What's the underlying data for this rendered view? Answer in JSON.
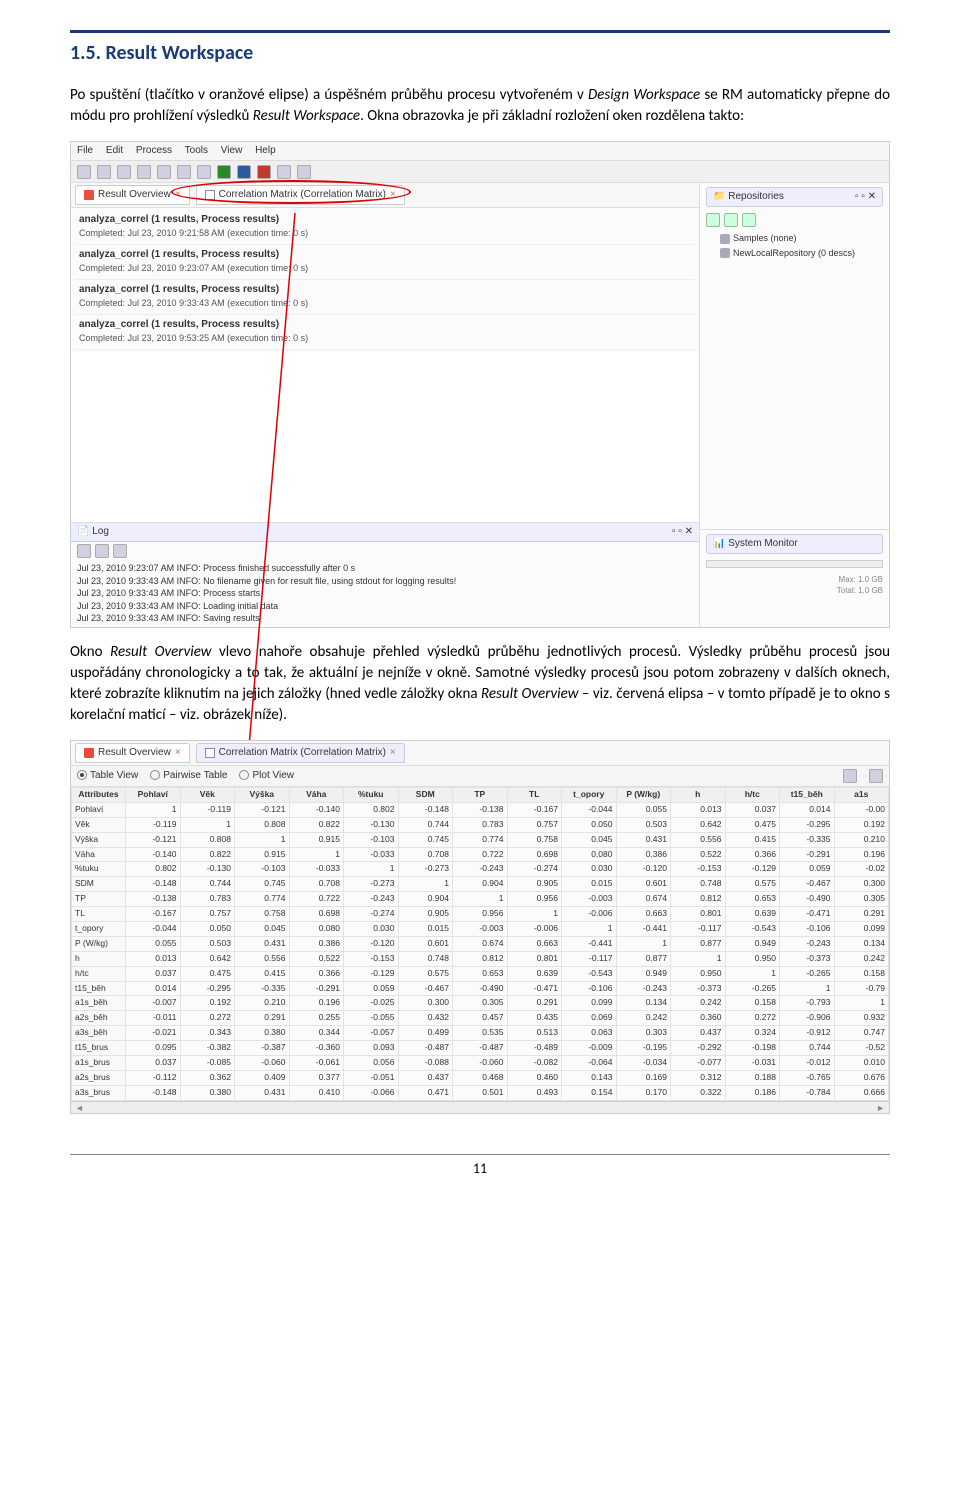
{
  "heading": "1.5. Result Workspace",
  "para1_parts": {
    "a": "Po spuštění (tlačítko v oranžové elipse) a úspěšném průběhu procesu vytvořeném v ",
    "b": "Design Workspace",
    "c": " se RM automaticky přepne do módu pro prohlížení výsledků ",
    "d": "Result Workspace",
    "e": ". Okna obrazovka je při základní rozložení oken rozdělena takto:"
  },
  "menubar": [
    "File",
    "Edit",
    "Process",
    "Tools",
    "View",
    "Help"
  ],
  "tabs": {
    "overview": "Result Overview",
    "corrmatrix": "Correlation Matrix (Correlation Matrix)"
  },
  "repositories": {
    "title": "Repositories",
    "items": [
      "Samples (none)",
      "NewLocalRepository (0 descs)"
    ]
  },
  "result_items": [
    {
      "title": "analyza_correl (1 results, Process results)",
      "sub": "Completed: Jul 23, 2010 9:21:58 AM (execution time: 0 s)"
    },
    {
      "title": "analyza_correl (1 results, Process results)",
      "sub": "Completed: Jul 23, 2010 9:23:07 AM (execution time: 0 s)"
    },
    {
      "title": "analyza_correl (1 results, Process results)",
      "sub": "Completed: Jul 23, 2010 9:33:43 AM (execution time: 0 s)"
    },
    {
      "title": "analyza_correl (1 results, Process results)",
      "sub": "Completed: Jul 23, 2010 9:53:25 AM (execution time: 0 s)"
    }
  ],
  "log": {
    "title": "Log",
    "lines": [
      "Jul 23, 2010 9:23:07 AM INFO: Process finished successfully after 0 s",
      "Jul 23, 2010 9:33:43 AM INFO: No filename given for result file, using stdout for logging results!",
      "Jul 23, 2010 9:33:43 AM INFO: Process starts",
      "Jul 23, 2010 9:33:43 AM INFO: Loading initial data",
      "Jul 23, 2010 9:33:43 AM INFO: Saving results"
    ]
  },
  "sysmon": {
    "title": "System Monitor",
    "max": "Max: 1.0 GB",
    "total": "Total: 1.0 GB"
  },
  "para2_parts": {
    "a": "Okno ",
    "b": "Result Overview",
    "c": " vlevo nahoře obsahuje přehled výsledků průběhu jednotlivých procesů. Výsledky průběhu procesů jsou uspořádány chronologicky a to tak, že aktuální je nejníže v okně. Samotné výsledky procesů jsou potom zobrazeny v dalších oknech, které zobrazíte kliknutím na jejich záložky (hned vedle záložky okna ",
    "d": "Result Overview",
    "e": " – viz. červená elipsa – v tomto případě je to okno s korelační maticí – viz. obrázek níže)."
  },
  "corr_views": {
    "table": "Table View",
    "pairwise": "Pairwise Table",
    "plot": "Plot View"
  },
  "corr_header": [
    "Attributes",
    "Pohlaví",
    "Věk",
    "Výška",
    "Váha",
    "%tuku",
    "SDM",
    "TP",
    "TL",
    "t_opory",
    "P (W/kg)",
    "h",
    "h/tc",
    "t15_běh",
    "a1s"
  ],
  "chart_data": {
    "type": "table",
    "title": "Correlation Matrix",
    "rows": [
      [
        "Pohlaví",
        "1",
        "-0.119",
        "-0.121",
        "-0.140",
        "0.802",
        "-0.148",
        "-0.138",
        "-0.167",
        "-0.044",
        "0.055",
        "0.013",
        "0.037",
        "0.014",
        "-0.00"
      ],
      [
        "Věk",
        "-0.119",
        "1",
        "0.808",
        "0.822",
        "-0.130",
        "0.744",
        "0.783",
        "0.757",
        "0.050",
        "0.503",
        "0.642",
        "0.475",
        "-0.295",
        "0.192"
      ],
      [
        "Výška",
        "-0.121",
        "0.808",
        "1",
        "0.915",
        "-0.103",
        "0.745",
        "0.774",
        "0.758",
        "0.045",
        "0.431",
        "0.556",
        "0.415",
        "-0.335",
        "0.210"
      ],
      [
        "Váha",
        "-0.140",
        "0.822",
        "0.915",
        "1",
        "-0.033",
        "0.708",
        "0.722",
        "0.698",
        "0.080",
        "0.386",
        "0.522",
        "0.366",
        "-0.291",
        "0.196"
      ],
      [
        "%tuku",
        "0.802",
        "-0.130",
        "-0.103",
        "-0.033",
        "1",
        "-0.273",
        "-0.243",
        "-0.274",
        "0.030",
        "-0.120",
        "-0.153",
        "-0.129",
        "0.059",
        "-0.02"
      ],
      [
        "SDM",
        "-0.148",
        "0.744",
        "0.745",
        "0.708",
        "-0.273",
        "1",
        "0.904",
        "0.905",
        "0.015",
        "0.601",
        "0.748",
        "0.575",
        "-0.467",
        "0.300"
      ],
      [
        "TP",
        "-0.138",
        "0.783",
        "0.774",
        "0.722",
        "-0.243",
        "0.904",
        "1",
        "0.956",
        "-0.003",
        "0.674",
        "0.812",
        "0.653",
        "-0.490",
        "0.305"
      ],
      [
        "TL",
        "-0.167",
        "0.757",
        "0.758",
        "0.698",
        "-0.274",
        "0.905",
        "0.956",
        "1",
        "-0.006",
        "0.663",
        "0.801",
        "0.639",
        "-0.471",
        "0.291"
      ],
      [
        "t_opory",
        "-0.044",
        "0.050",
        "0.045",
        "0.080",
        "0.030",
        "0.015",
        "-0.003",
        "-0.006",
        "1",
        "-0.441",
        "-0.117",
        "-0.543",
        "-0.106",
        "0.099"
      ],
      [
        "P (W/kg)",
        "0.055",
        "0.503",
        "0.431",
        "0.386",
        "-0.120",
        "0.601",
        "0.674",
        "0.663",
        "-0.441",
        "1",
        "0.877",
        "0.949",
        "-0.243",
        "0.134"
      ],
      [
        "h",
        "0.013",
        "0.642",
        "0.556",
        "0.522",
        "-0.153",
        "0.748",
        "0.812",
        "0.801",
        "-0.117",
        "0.877",
        "1",
        "0.950",
        "-0.373",
        "0.242"
      ],
      [
        "h/tc",
        "0.037",
        "0.475",
        "0.415",
        "0.366",
        "-0.129",
        "0.575",
        "0.653",
        "0.639",
        "-0.543",
        "0.949",
        "0.950",
        "1",
        "-0.265",
        "0.158"
      ],
      [
        "t15_běh",
        "0.014",
        "-0.295",
        "-0.335",
        "-0.291",
        "0.059",
        "-0.467",
        "-0.490",
        "-0.471",
        "-0.106",
        "-0.243",
        "-0.373",
        "-0.265",
        "1",
        "-0.79"
      ],
      [
        "a1s_běh",
        "-0.007",
        "0.192",
        "0.210",
        "0.196",
        "-0.025",
        "0.300",
        "0.305",
        "0.291",
        "0.099",
        "0.134",
        "0.242",
        "0.158",
        "-0.793",
        "1"
      ],
      [
        "a2s_běh",
        "-0.011",
        "0.272",
        "0.291",
        "0.255",
        "-0.055",
        "0.432",
        "0.457",
        "0.435",
        "0.069",
        "0.242",
        "0.360",
        "0.272",
        "-0.906",
        "0.932"
      ],
      [
        "a3s_běh",
        "-0.021",
        "0.343",
        "0.380",
        "0.344",
        "-0.057",
        "0.499",
        "0.535",
        "0.513",
        "0.063",
        "0.303",
        "0.437",
        "0.324",
        "-0.912",
        "0.747"
      ],
      [
        "t15_brus",
        "0.095",
        "-0.382",
        "-0.387",
        "-0.360",
        "0.093",
        "-0.487",
        "-0.487",
        "-0.489",
        "-0.009",
        "-0.195",
        "-0.292",
        "-0.198",
        "0.744",
        "-0.52"
      ],
      [
        "a1s_brus",
        "0.037",
        "-0.085",
        "-0.060",
        "-0.061",
        "0.056",
        "-0.088",
        "-0.060",
        "-0.082",
        "-0.064",
        "-0.034",
        "-0.077",
        "-0.031",
        "-0.012",
        "0.010"
      ],
      [
        "a2s_brus",
        "-0.112",
        "0.362",
        "0.409",
        "0.377",
        "-0.051",
        "0.437",
        "0.468",
        "0.460",
        "0.143",
        "0.169",
        "0.312",
        "0.188",
        "-0.765",
        "0.676"
      ],
      [
        "a3s_brus",
        "-0.148",
        "0.380",
        "0.431",
        "0.410",
        "-0.066",
        "0.471",
        "0.501",
        "0.493",
        "0.154",
        "0.170",
        "0.322",
        "0.186",
        "-0.784",
        "0.666"
      ]
    ]
  },
  "pagenum": "11"
}
